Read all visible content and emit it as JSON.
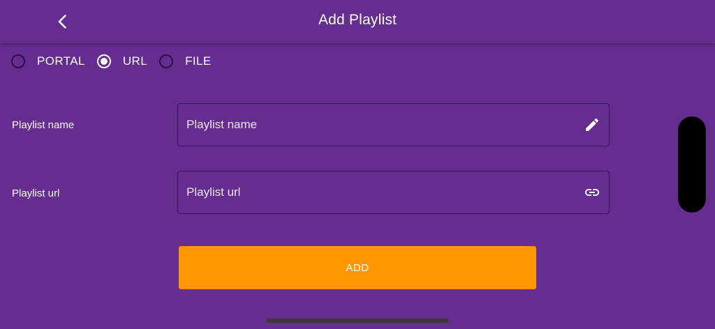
{
  "header": {
    "title": "Add Playlist",
    "back_icon": "chevron-left-icon"
  },
  "source_options": [
    {
      "label": "PORTAL",
      "selected": false
    },
    {
      "label": "URL",
      "selected": true
    },
    {
      "label": "FILE",
      "selected": false
    }
  ],
  "form": {
    "name": {
      "label": "Playlist name",
      "value": "",
      "placeholder": "Playlist name",
      "icon": "pencil-icon"
    },
    "url": {
      "label": "Playlist url",
      "value": "",
      "placeholder": "Playlist url",
      "icon": "link-icon"
    }
  },
  "add_button": {
    "label": "ADD"
  },
  "colors": {
    "background": "#662d91",
    "accent": "#ff9800",
    "text": "#ffffff"
  }
}
